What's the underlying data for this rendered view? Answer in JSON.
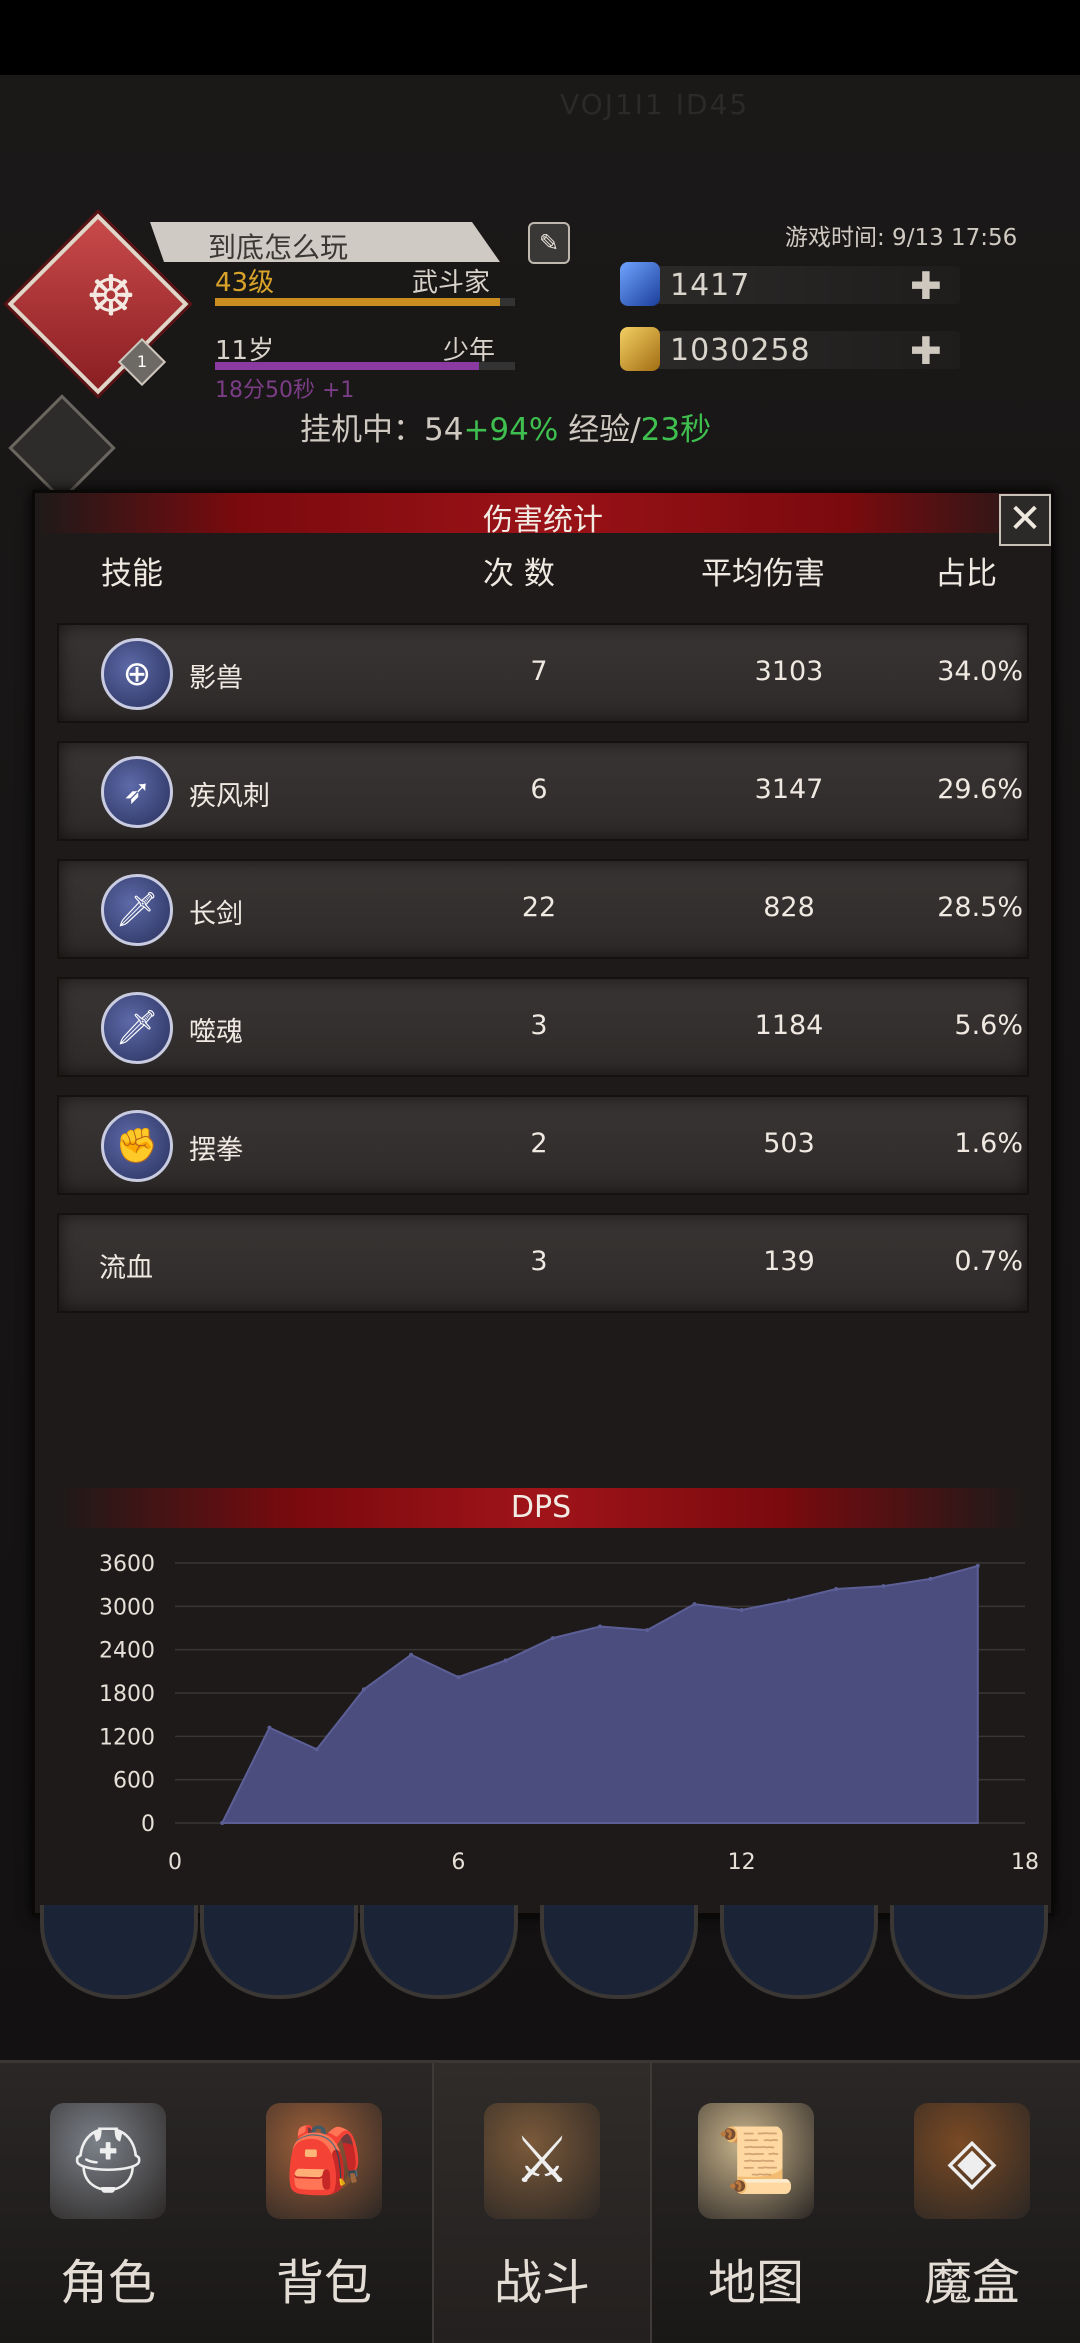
{
  "status": {
    "blurred_title": "VOJ1I1 ID45"
  },
  "player": {
    "name": "到底怎么玩",
    "level": "43级",
    "class": "武斗家",
    "level_progress": 0.95,
    "age": "11岁",
    "age_stage": "少年",
    "age_progress": 0.88,
    "age_timer": "18分50秒 +1",
    "emblem_rank": "1"
  },
  "game_time": "游戏时间: 9/13 17:56",
  "resources": {
    "gems": "1417",
    "gold": "1030258"
  },
  "idle": {
    "prefix": "挂机中：54",
    "bonus": "+94%",
    "exp_label": " 经验/",
    "exp_rate": "23秒"
  },
  "panel": {
    "title": "伤害统计",
    "headers": {
      "skill": "技能",
      "count": "次 数",
      "avg": "平均伤害",
      "share": "占比"
    },
    "rows": [
      {
        "name": "影兽",
        "count": "7",
        "avg": "3103",
        "share": "34.0%",
        "icon": "shadow-beast-icon",
        "glyph": "⊕"
      },
      {
        "name": "疾风刺",
        "count": "6",
        "avg": "3147",
        "share": "29.6%",
        "icon": "gale-thrust-icon",
        "glyph": "➶"
      },
      {
        "name": "长剑",
        "count": "22",
        "avg": "828",
        "share": "28.5%",
        "icon": "longsword-icon",
        "glyph": "🗡"
      },
      {
        "name": "噬魂",
        "count": "3",
        "avg": "1184",
        "share": "5.6%",
        "icon": "soul-devour-icon",
        "glyph": "🗡"
      },
      {
        "name": "摆拳",
        "count": "2",
        "avg": "503",
        "share": "1.6%",
        "icon": "swing-punch-icon",
        "glyph": "✊"
      },
      {
        "name": "流血",
        "count": "3",
        "avg": "139",
        "share": "0.7%",
        "icon": null,
        "glyph": ""
      }
    ]
  },
  "chart_data": {
    "type": "area",
    "title": "DPS",
    "xlabel": "",
    "ylabel": "",
    "x": [
      1,
      2,
      3,
      4,
      5,
      6,
      7,
      8,
      9,
      10,
      11,
      12,
      13,
      14,
      15,
      16,
      17
    ],
    "values": [
      0,
      1320,
      1020,
      1850,
      2330,
      2020,
      2250,
      2560,
      2720,
      2670,
      3030,
      2950,
      3080,
      3240,
      3280,
      3380,
      3560
    ],
    "xlim": [
      0,
      18
    ],
    "ylim": [
      0,
      3600
    ],
    "x_ticks": [
      "0",
      "6",
      "12",
      "18"
    ],
    "y_ticks": [
      "0",
      "600",
      "1200",
      "1800",
      "2400",
      "3000",
      "3600"
    ],
    "fill_color": "#4b4d7e",
    "grid": true
  },
  "nav": [
    {
      "label": "角色",
      "icon": "helmet-icon",
      "active": false
    },
    {
      "label": "背包",
      "icon": "backpack-icon",
      "active": false
    },
    {
      "label": "战斗",
      "icon": "sword-shield-icon",
      "active": true
    },
    {
      "label": "地图",
      "icon": "map-scroll-icon",
      "active": false
    },
    {
      "label": "魔盒",
      "icon": "magic-box-icon",
      "active": false
    }
  ]
}
